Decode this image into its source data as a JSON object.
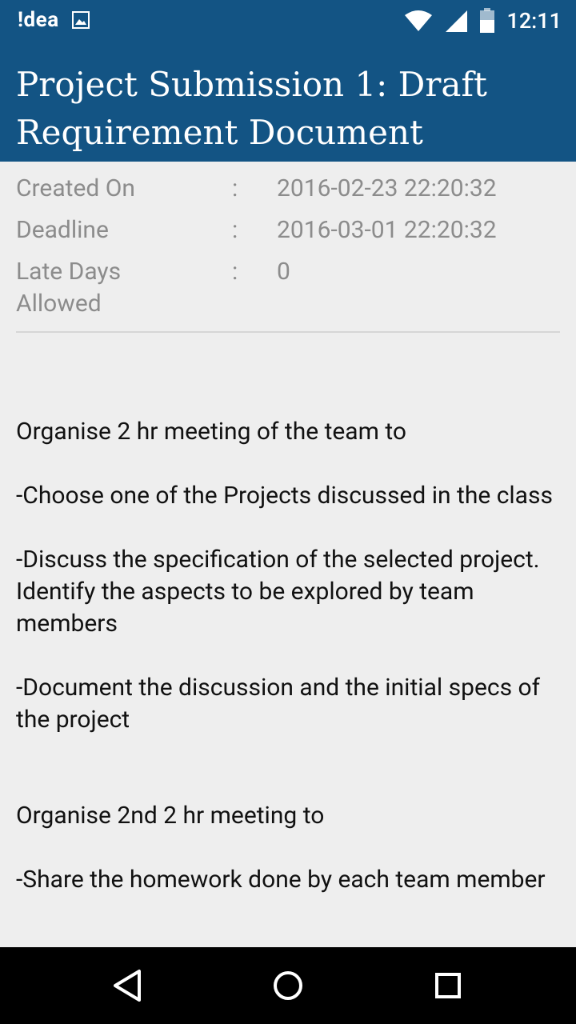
{
  "status_bar": {
    "carrier": "!dea",
    "time": "12:11",
    "icons": [
      "image-icon",
      "wifi-icon",
      "cellular-icon",
      "battery-icon"
    ]
  },
  "header": {
    "title": "Project Submission 1: Draft Requirement Document"
  },
  "meta": {
    "created_label": "Created On",
    "created_value": "2016-02-23 22:20:32",
    "deadline_label": "Deadline",
    "deadline_value": "2016-03-01 22:20:32",
    "late_label": "Late Days Allowed",
    "late_value": "0",
    "separator": ":"
  },
  "description": {
    "p1": "Organise 2 hr meeting of the team to",
    "p2": "-Choose one of the Projects discussed in the class",
    "p3": "-Discuss the specification of the selected project. Identify the aspects to be explored by team members",
    "p4": "-Document the discussion and the initial specs of the project",
    "p5": "Organise 2nd 2 hr meeting  to",
    "p6": "-Share the homework done by each team member"
  },
  "nav": {
    "buttons": [
      "back-icon",
      "home-icon",
      "recents-icon"
    ]
  },
  "colors": {
    "primary": "#135484",
    "background": "#eeeeee",
    "meta_text": "#8c8c8c",
    "body_text": "#111111"
  }
}
